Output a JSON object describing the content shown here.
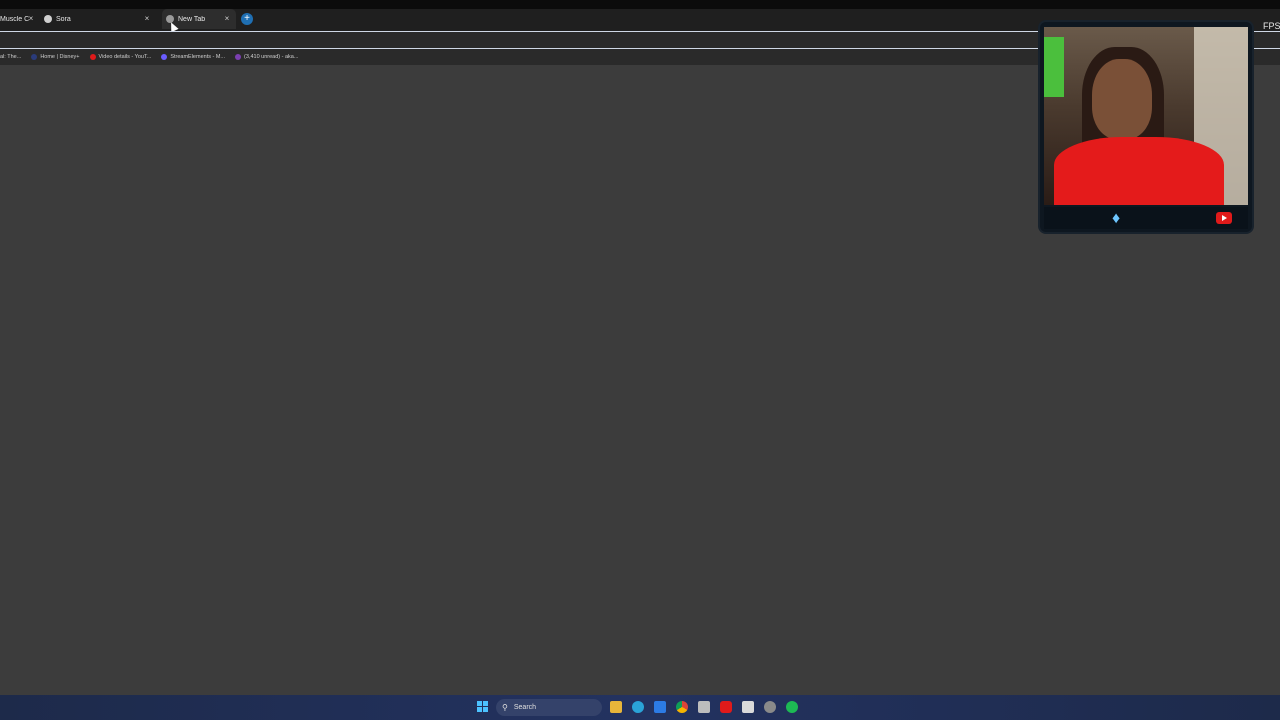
{
  "browser": {
    "tabs": [
      {
        "label": "Muscle C",
        "favicon_color": "#cccccc",
        "close": "×"
      },
      {
        "label": "Sora",
        "favicon_color": "#d0d0d0",
        "close": "×"
      },
      {
        "label": "New Tab",
        "favicon_color": "#bbbbbb",
        "close": "×",
        "active": true
      }
    ],
    "new_tab": "+",
    "bookmarks": [
      {
        "label": "al: The...",
        "icon_color": "#888888"
      },
      {
        "label": "Home | Disney+",
        "icon_color": "#2a3b7a"
      },
      {
        "label": "Video details - YouT...",
        "icon_color": "#e01a1a"
      },
      {
        "label": "StreamElements - M...",
        "icon_color": "#6a5cff"
      },
      {
        "label": "(3,410 unread) - aka...",
        "icon_color": "#7b3fb0"
      }
    ]
  },
  "overlay": {
    "fps_label": "FPS",
    "twitter_icon": "twitter-icon",
    "youtube_icon": "youtube-icon"
  },
  "taskbar": {
    "search_label": "Search",
    "icons": [
      "file-explorer-icon",
      "edge-icon",
      "mail-icon",
      "chrome-icon",
      "calculator-icon",
      "youtube-icon",
      "app-icon",
      "refresh-icon",
      "spotify-icon"
    ]
  }
}
